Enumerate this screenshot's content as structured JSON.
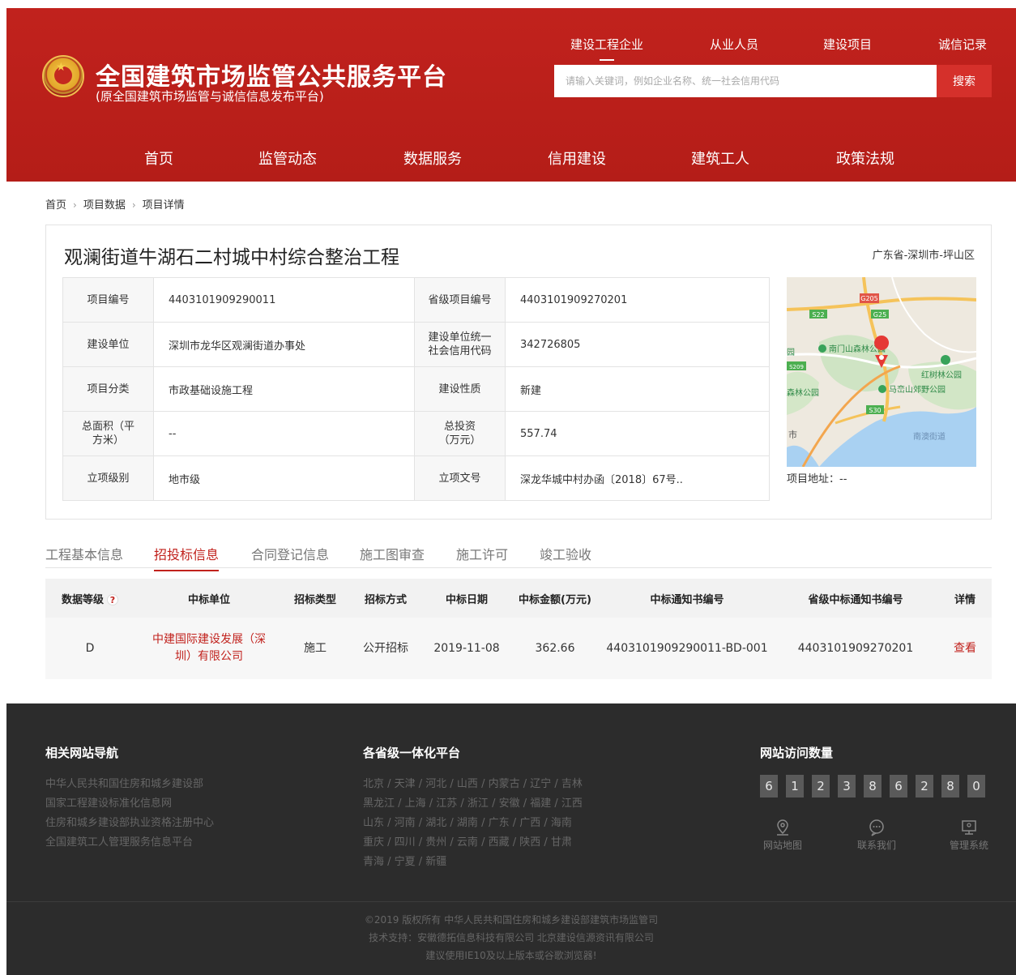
{
  "header": {
    "title": "全国建筑市场监管公共服务平台",
    "subtitle": "(原全国建筑市场监管与诚信信息发布平台)",
    "top_nav": [
      "建设工程企业",
      "从业人员",
      "建设项目",
      "诚信记录"
    ],
    "search_placeholder": "请输入关键词，例如企业名称、统一社会信用代码",
    "search_button": "搜索",
    "main_nav": [
      "首页",
      "监管动态",
      "数据服务",
      "信用建设",
      "建筑工人",
      "政策法规"
    ],
    "brand_color": "#c1221d"
  },
  "breadcrumb": [
    "首页",
    "项目数据",
    "项目详情"
  ],
  "project": {
    "title": "观澜街道牛湖石二村城中村综合整治工程",
    "region": "广东省-深圳市-坪山区",
    "fields": {
      "code_label": "项目编号",
      "code": "4403101909290011",
      "prov_code_label": "省级项目编号",
      "prov_code": "4403101909270201",
      "builder_label": "建设单位",
      "builder": "深圳市龙华区观澜街道办事处",
      "credit_label": "建设单位统一社会信用代码",
      "credit": "342726805",
      "category_label": "项目分类",
      "category": "市政基础设施工程",
      "nature_label": "建设性质",
      "nature": "新建",
      "area_label": "总面积（平方米）",
      "area": "--",
      "invest_label": "总投资（万元）",
      "invest": "557.74",
      "level_label": "立项级别",
      "level": "地市级",
      "docno_label": "立项文号",
      "docno": "深龙华城中村办函〔2018〕67号.."
    },
    "map_address": "项目地址：--",
    "map_labels": {
      "g205": "G205",
      "g25": "G25",
      "s22": "S22",
      "s209": "S209",
      "s30": "S30",
      "park1": "南门山森林公园",
      "park2": "红树林公园",
      "park3": "马峦山郊野公园",
      "park4": "森林公园",
      "left_edge": "园",
      "city": "市",
      "town": "南澳街道"
    }
  },
  "tabs": [
    "工程基本信息",
    "招投标信息",
    "合同登记信息",
    "施工图审查",
    "施工许可",
    "竣工验收"
  ],
  "bid_table": {
    "headers": [
      "数据等级",
      "中标单位",
      "招标类型",
      "招标方式",
      "中标日期",
      "中标金额(万元)",
      "中标通知书编号",
      "省级中标通知书编号",
      "详情"
    ],
    "help_mark": "?",
    "rows": [
      {
        "grade": "D",
        "winner": "中建国际建设发展（深圳）有限公司",
        "type": "施工",
        "method": "公开招标",
        "date": "2019-11-08",
        "amount": "362.66",
        "notice_no": "4403101909290011-BD-001",
        "prov_notice_no": "4403101909270201",
        "detail": "查看"
      }
    ]
  },
  "footer": {
    "nav_title": "相关网站导航",
    "nav_links": [
      "中华人民共和国住房和城乡建设部",
      "国家工程建设标准化信息网",
      "住房和城乡建设部执业资格注册中心",
      "全国建筑工人管理服务信息平台"
    ],
    "prov_title": "各省级一体化平台",
    "prov_lines": [
      "北京 / 天津 / 河北 / 山西 / 内蒙古 / 辽宁 / 吉林",
      "黑龙江 / 上海 / 江苏 / 浙江 / 安徽 / 福建 / 江西",
      "山东 / 河南 / 湖北 / 湖南 / 广东 / 广西 / 海南",
      "重庆 / 四川 / 贵州 / 云南 / 西藏 / 陕西 / 甘肃",
      "青海 / 宁夏 / 新疆"
    ],
    "visit_title": "网站访问数量",
    "visit_digits": [
      "6",
      "1",
      "2",
      "3",
      "8",
      "6",
      "2",
      "8",
      "0"
    ],
    "quick_links": [
      {
        "label": "网站地图",
        "icon": "map-pin-icon"
      },
      {
        "label": "联系我们",
        "icon": "chat-bubble-icon"
      },
      {
        "label": "管理系统",
        "icon": "monitor-icon"
      }
    ],
    "copyright": [
      "©2019 版权所有 中华人民共和国住房和城乡建设部建筑市场监管司",
      "技术支持：安徽德拓信息科技有限公司 北京建设信源资讯有限公司",
      "建议使用IE10及以上版本或谷歌浏览器!"
    ]
  }
}
